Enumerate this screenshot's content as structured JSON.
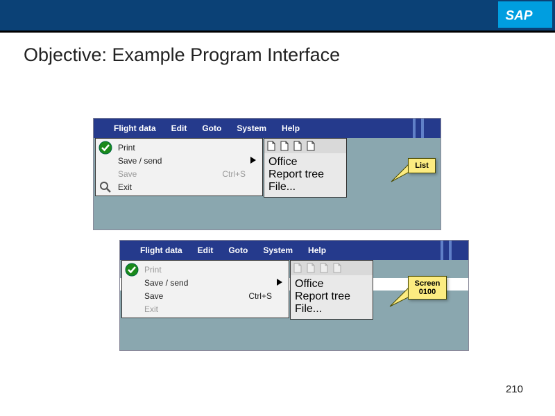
{
  "logo": "SAP",
  "title": "Objective: Example Program Interface",
  "page_number": "210",
  "menubar": {
    "flight_data": "Flight data",
    "edit": "Edit",
    "goto": "Goto",
    "system": "System",
    "help": "Help"
  },
  "dropdown": {
    "print": "Print",
    "save_send": "Save / send",
    "save": "Save",
    "save_shortcut": "Ctrl+S",
    "exit": "Exit"
  },
  "submenu": {
    "office": "Office",
    "report_tree": "Report tree",
    "file": "File..."
  },
  "callouts": {
    "list": "List",
    "screen0100a": "Screen",
    "screen0100b": "0100"
  }
}
